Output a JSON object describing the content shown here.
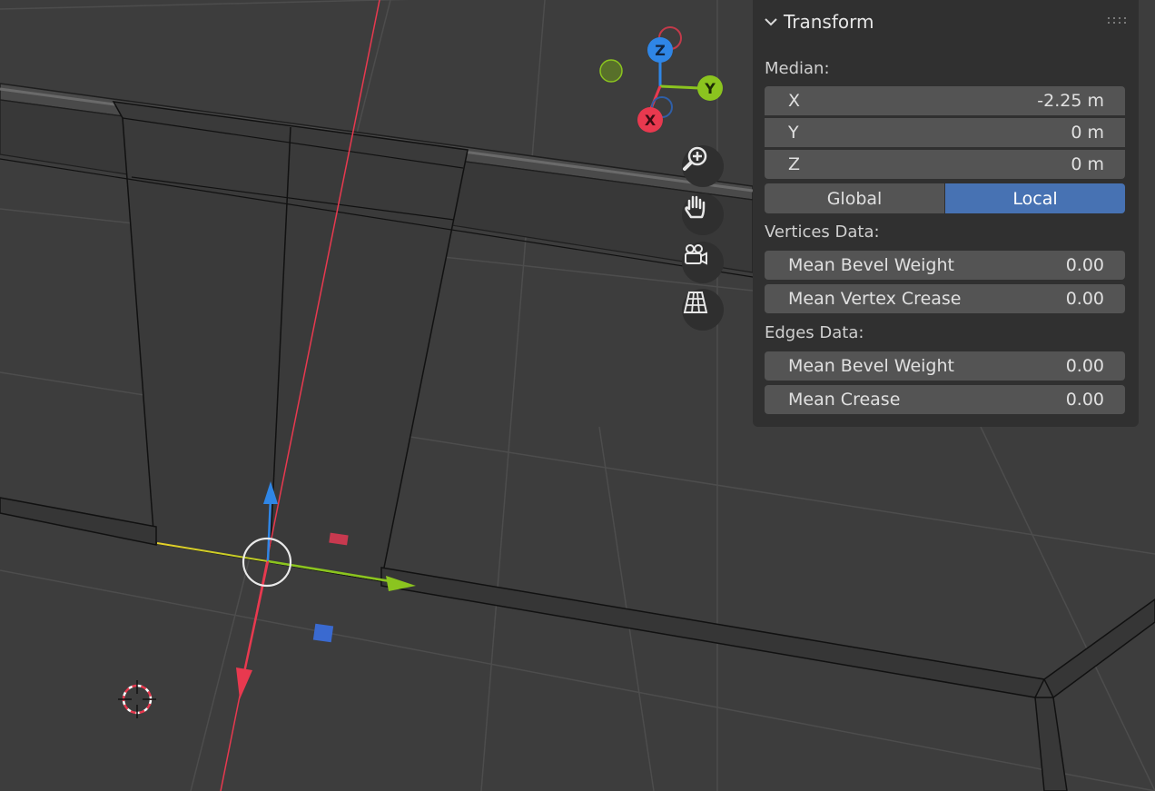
{
  "viewport": {
    "gizmo": {
      "x_label": "X",
      "y_label": "Y",
      "z_label": "Z"
    },
    "nav_buttons": [
      "zoom-icon",
      "pan-hand-icon",
      "camera-icon",
      "perspective-grid-icon"
    ],
    "colors": {
      "background": "#3d3d3d",
      "x_axis": "#e8394f",
      "y_axis": "#8bc41f",
      "z_axis": "#2f86e6",
      "selection_edge": "#e6d12a",
      "active_button": "#4772b3"
    }
  },
  "panel": {
    "title": "Transform",
    "median_label": "Median:",
    "median": [
      {
        "label": "X",
        "value": "-2.25 m"
      },
      {
        "label": "Y",
        "value": "0 m"
      },
      {
        "label": "Z",
        "value": "0 m"
      }
    ],
    "space_toggle": {
      "global": "Global",
      "local": "Local",
      "active": "Local"
    },
    "vertices_label": "Vertices Data:",
    "vertices": [
      {
        "label": "Mean Bevel Weight",
        "value": "0.00"
      },
      {
        "label": "Mean Vertex Crease",
        "value": "0.00"
      }
    ],
    "edges_label": "Edges Data:",
    "edges": [
      {
        "label": "Mean Bevel Weight",
        "value": "0.00"
      },
      {
        "label": "Mean Crease",
        "value": "0.00"
      }
    ]
  }
}
